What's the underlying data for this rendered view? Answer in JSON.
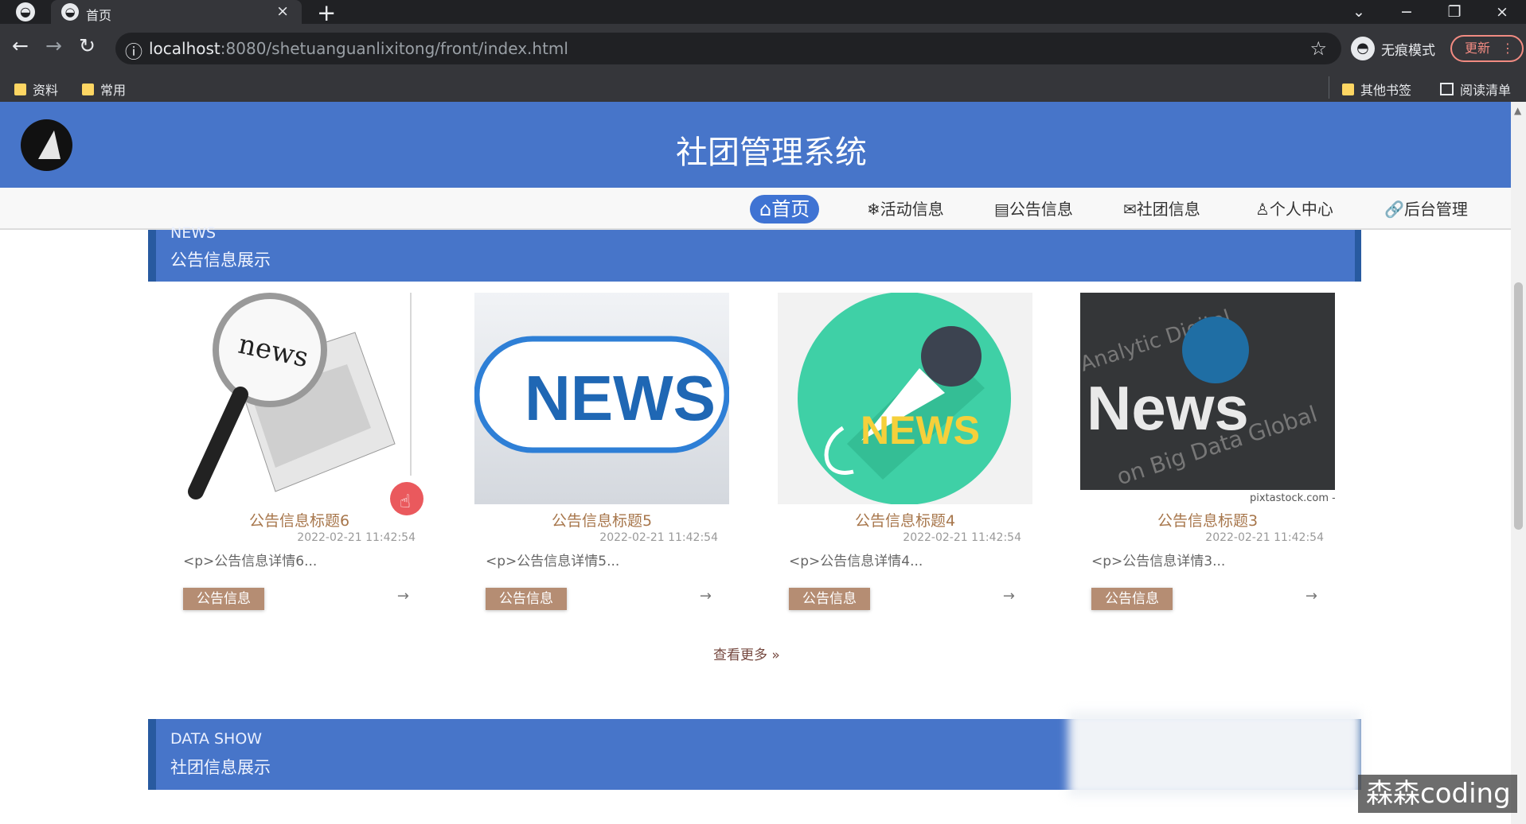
{
  "browser": {
    "tab_title": "首页",
    "url_host": "localhost",
    "url_rest": ":8080/shetuanguanlixitong/front/index.html",
    "incognito_label": "无痕模式",
    "update_label": "更新",
    "bookmarks": [
      "资料",
      "常用"
    ],
    "other_bookmarks": "其他书签",
    "reading_list": "阅读清单"
  },
  "site": {
    "title": "社团管理系统",
    "nav": [
      {
        "icon": "home-icon",
        "label": "⌂首页"
      },
      {
        "icon": "activity-icon",
        "label": "❄活动信息"
      },
      {
        "icon": "notice-icon",
        "label": "▤公告信息"
      },
      {
        "icon": "club-icon",
        "label": "✉社团信息"
      },
      {
        "icon": "user-icon",
        "label": "♙个人中心"
      },
      {
        "icon": "link-icon",
        "label": "🔗后台管理"
      }
    ]
  },
  "news_section": {
    "label_en": "NEWS",
    "label_cn": "公告信息展示",
    "cards": [
      {
        "title": "公告信息标题6",
        "date": "2022-02-21 11:42:54",
        "desc": "<p>公告信息详情6...",
        "tag": "公告信息",
        "arrow": "→"
      },
      {
        "title": "公告信息标题5",
        "date": "2022-02-21 11:42:54",
        "desc": "<p>公告信息详情5...",
        "tag": "公告信息",
        "arrow": "→"
      },
      {
        "title": "公告信息标题4",
        "date": "2022-02-21 11:42:54",
        "desc": "<p>公告信息详情4...",
        "tag": "公告信息",
        "arrow": "→"
      },
      {
        "title": "公告信息标题3",
        "date": "2022-02-21 11:42:54",
        "desc": "<p>公告信息详情3...",
        "tag": "公告信息",
        "arrow": "→"
      }
    ],
    "more_label": "查看更多 »"
  },
  "data_section": {
    "label_en": "DATA SHOW",
    "label_cn": "社团信息展示"
  },
  "watermark": "森森coding"
}
